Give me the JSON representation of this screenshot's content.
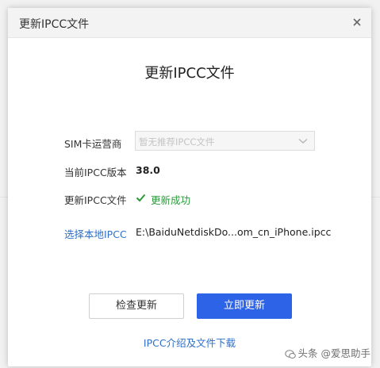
{
  "window": {
    "title": "更新IPCC文件",
    "close_symbol": "×"
  },
  "main": {
    "heading": "更新IPCC文件",
    "sim_label": "SIM卡运营商",
    "sim_select_placeholder": "暂无推荐IPCC文件",
    "current_version_label": "当前IPCC版本",
    "current_version_value": "38.0",
    "update_file_label": "更新IPCC文件",
    "update_status": "更新成功",
    "choose_local_link": "选择本地IPCC",
    "file_path": "E:\\BaiduNetdiskDo...om_cn_iPhone.ipcc"
  },
  "buttons": {
    "check_update": "检查更新",
    "update_now": "立即更新"
  },
  "footer": {
    "intro_link": "IPCC介绍及文件下载"
  },
  "watermark": {
    "text": "头条 @爱思助手"
  },
  "colors": {
    "primary": "#2d63e6",
    "link": "#2f6fc5",
    "success": "#2a9a3a"
  },
  "icons": {
    "close": "close-icon",
    "chevron": "chevron-down-icon",
    "check": "check-icon"
  }
}
